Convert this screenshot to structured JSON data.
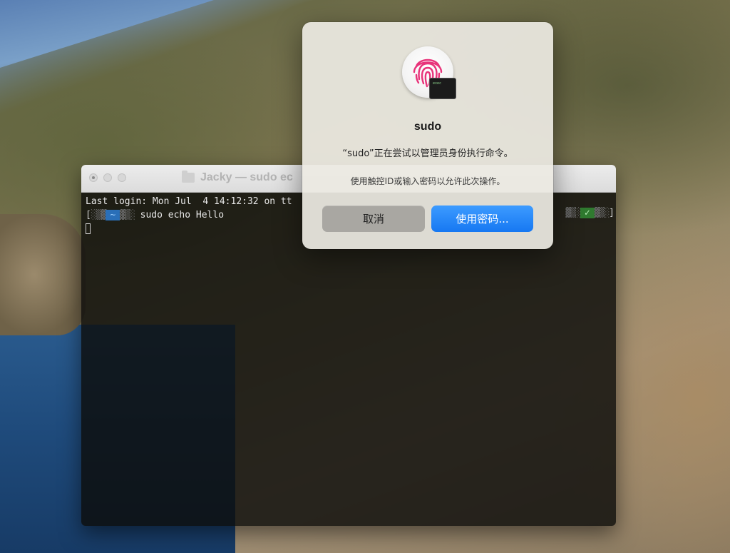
{
  "terminal": {
    "title": "Jacky — sudo ec",
    "lines": {
      "login": "Last login: Mon Jul  4 14:12:32 on tt",
      "prompt_open": "[",
      "prompt_fill_left": "░▒▓",
      "prompt_fill_mid": "▓▒░",
      "prompt_dir": "~",
      "command": "sudo echo Hello",
      "prompt_close": "]",
      "status_ok": "✓"
    }
  },
  "dialog": {
    "title": "sudo",
    "message": "“sudo”正在尝试以管理员身份执行命令。",
    "sub": "使用触控ID或输入密码以允许此次操作。",
    "cancel_label": "取消",
    "primary_label": "使用密码...",
    "badge_text": "exec"
  },
  "colors": {
    "accent": "#1678f2",
    "fingerprint": "#e8337a"
  }
}
